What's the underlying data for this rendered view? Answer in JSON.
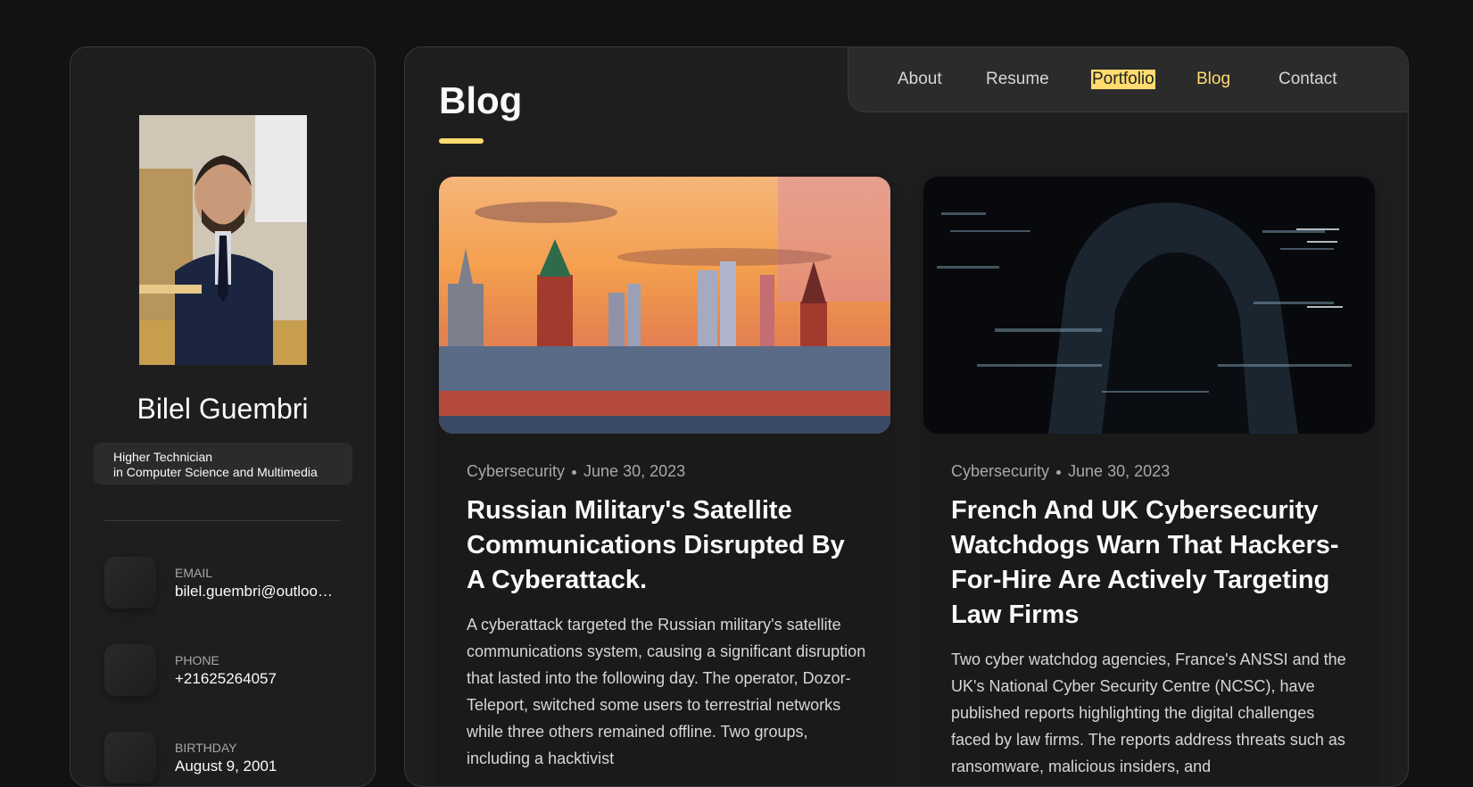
{
  "profile": {
    "name": "Bilel Guembri",
    "title_line1": "Higher Technician",
    "title_line2": "in Computer Science and Multimedia"
  },
  "contacts": [
    {
      "label": "EMAIL",
      "value": "bilel.guembri@outlook.com",
      "icon": "mail-icon"
    },
    {
      "label": "PHONE",
      "value": "+21625264057",
      "icon": "phone-icon"
    },
    {
      "label": "BIRTHDAY",
      "value": "August 9, 2001",
      "icon": "calendar-icon"
    }
  ],
  "nav": {
    "items": [
      "About",
      "Resume",
      "Portfolio",
      "Blog",
      "Contact"
    ],
    "active": "Blog",
    "highlighted": "Portfolio"
  },
  "page": {
    "title": "Blog"
  },
  "posts": [
    {
      "category": "Cybersecurity",
      "date": "June 30, 2023",
      "title": "Russian Military's Satellite Communications Disrupted By A Cyberattack.",
      "excerpt": "A cyberattack targeted the Russian military's satellite communications system, causing a significant disruption that lasted into the following day. The operator, Dozor-Teleport, switched some users to terrestrial networks while three others remained offline. Two groups, including a hacktivist",
      "image": "moscow-kremlin-skyline"
    },
    {
      "category": "Cybersecurity",
      "date": "June 30, 2023",
      "title": "French And UK Cybersecurity Watchdogs Warn That Hackers-For-Hire Are Actively Targeting Law Firms",
      "excerpt": "Two cyber watchdog agencies, France's ANSSI and the UK's National Cyber Security Centre (NCSC), have published reports highlighting the digital challenges faced by law firms. The reports address threats such as ransomware, malicious insiders, and",
      "image": "hooded-hacker"
    }
  ],
  "colors": {
    "accent": "#ffdb70",
    "background": "#121212",
    "panel": "#1e1e1f"
  }
}
